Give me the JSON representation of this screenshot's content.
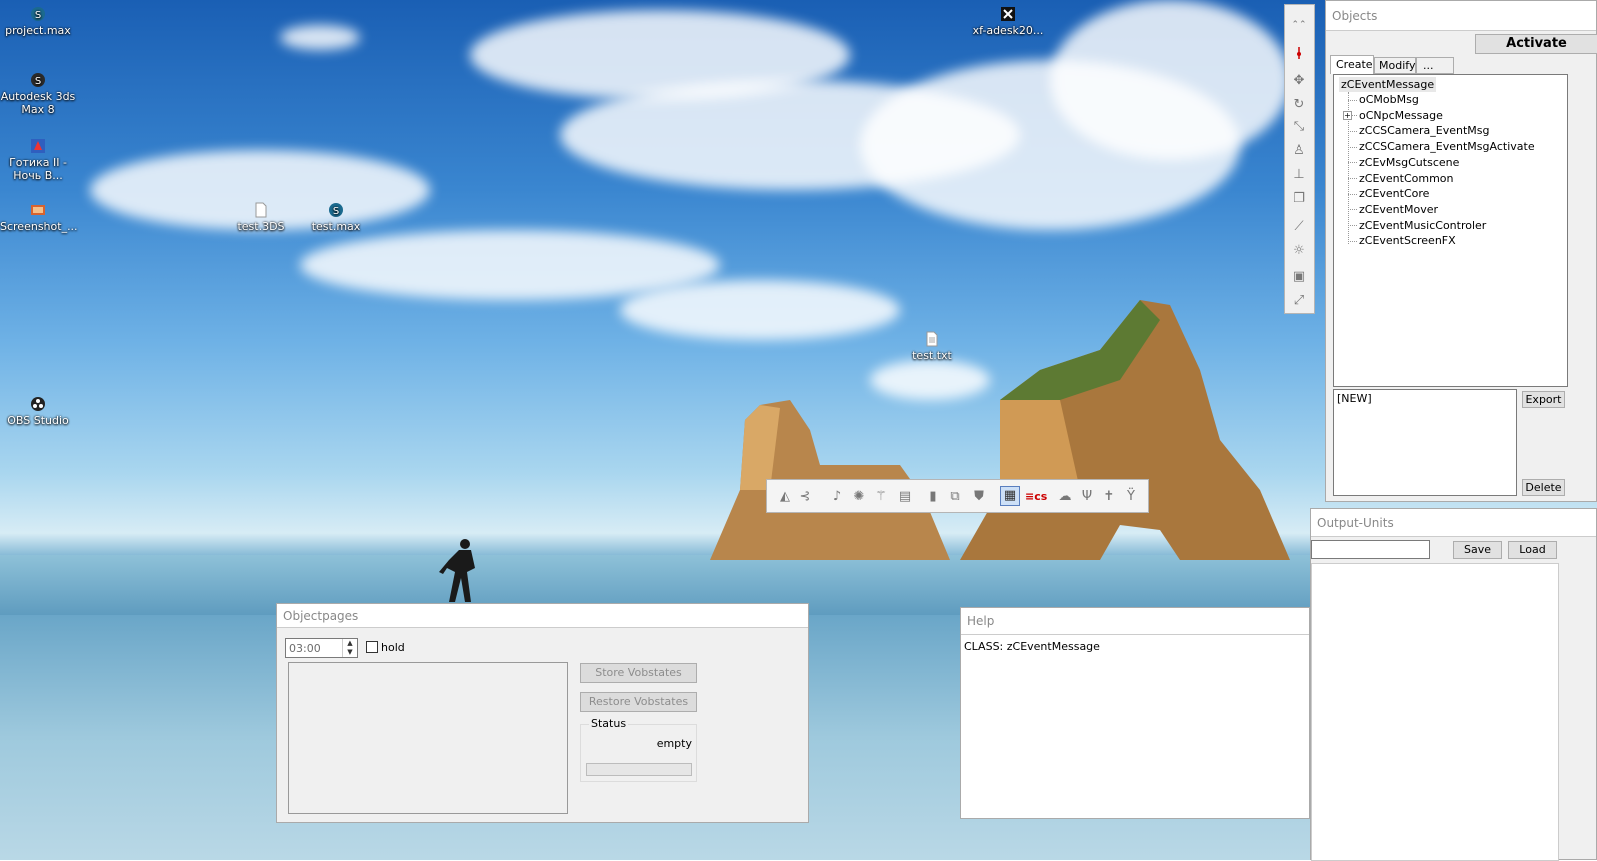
{
  "desktop": {
    "icons": [
      {
        "label": "project.max",
        "icon": "3ds-max-icon"
      },
      {
        "label": "Autodesk 3ds Max 8",
        "icon": "3ds-max-icon"
      },
      {
        "label": "Готика II - Ночь В...",
        "icon": "gothic-icon"
      },
      {
        "label": "Screenshot_...",
        "icon": "image-file-icon"
      },
      {
        "label": "test.3DS",
        "icon": "blank-file-icon"
      },
      {
        "label": "test.max",
        "icon": "3ds-max-icon"
      },
      {
        "label": "OBS Studio",
        "icon": "obs-icon"
      },
      {
        "label": "xf-adesk20...",
        "icon": "keygen-icon"
      },
      {
        "label": "test.txt",
        "icon": "text-file-icon"
      }
    ]
  },
  "objects_panel": {
    "title": "Objects",
    "activate_label": "Activate",
    "tabs": [
      "Create",
      "Modify",
      "..."
    ],
    "active_tab": "Create",
    "tree": {
      "root": "zCEventMessage",
      "children": [
        {
          "label": "oCMobMsg",
          "expandable": false
        },
        {
          "label": "oCNpcMessage",
          "expandable": true
        },
        {
          "label": "zCCSCamera_EventMsg",
          "expandable": false
        },
        {
          "label": "zCCSCamera_EventMsgActivate",
          "expandable": false
        },
        {
          "label": "zCEvMsgCutscene",
          "expandable": false
        },
        {
          "label": "zCEventCommon",
          "expandable": false
        },
        {
          "label": "zCEventCore",
          "expandable": false
        },
        {
          "label": "zCEventMover",
          "expandable": false
        },
        {
          "label": "zCEventMusicControler",
          "expandable": false
        },
        {
          "label": "zCEventScreenFX",
          "expandable": false
        }
      ]
    },
    "preset_list": [
      "[NEW]"
    ],
    "export_label": "Export",
    "delete_label": "Delete"
  },
  "output_units": {
    "title": "Output-Units",
    "input_value": "",
    "save_label": "Save",
    "load_label": "Load"
  },
  "objectpages": {
    "title": "Objectpages",
    "time_value": "03:00",
    "hold_label": "hold",
    "hold_checked": false,
    "store_label": "Store Vobstates",
    "restore_label": "Restore Vobstates",
    "status_group_label": "Status",
    "status_value": "empty",
    "progress": 0
  },
  "help": {
    "title": "Help",
    "text": "CLASS: zCEventMessage"
  },
  "vertical_toolbar": {
    "tools": [
      "collapse-icon",
      "pointer-icon",
      "move-icon",
      "rotate-icon",
      "scale-icon",
      "walk-icon",
      "ground-icon",
      "multi-object-icon",
      "pin-icon",
      "light-icon",
      "camera-icon",
      "camera-move-icon"
    ]
  },
  "horizontal_toolbar": {
    "tools": [
      "cone-icon",
      "bone-icon",
      "music-icon",
      "sun-icon",
      "wand-icon",
      "film-icon",
      "page-icon",
      "cubes-icon",
      "shield-icon",
      "properties-icon",
      "cutscene-icon",
      "fog-icon",
      "tree-icon",
      "pole-icon",
      "tree-alt-icon"
    ]
  },
  "colors": {
    "window_bg": "#f0f0f0",
    "title_text": "#888888",
    "disabled_text": "#8d8d8d",
    "cutscene_accent": "#cc0000"
  }
}
